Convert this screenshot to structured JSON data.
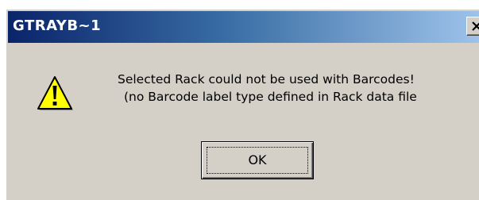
{
  "window": {
    "title": "GTRAYB~1",
    "close_glyph": "X"
  },
  "message": {
    "icon": "warning-icon",
    "line1": "Selected Rack could not be used with Barcodes!",
    "line2": "(no Barcode label type defined in Rack data file"
  },
  "buttons": {
    "ok_label": "OK"
  },
  "colors": {
    "titlebar_start": "#0a246a",
    "titlebar_end": "#a6caf0",
    "dialog_face": "#d4d0c8",
    "warning_yellow": "#ffff00"
  }
}
